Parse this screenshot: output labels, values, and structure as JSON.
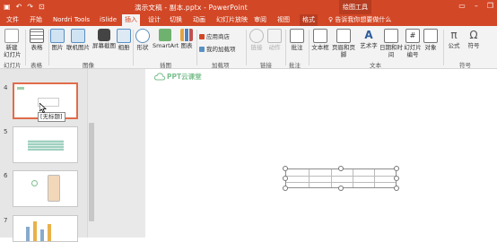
{
  "window": {
    "title": "演示文稿 - 副本.pptx - PowerPoint",
    "context_tool": "绘图工具",
    "qat_icons": [
      "save-icon",
      "undo-icon",
      "redo-icon",
      "start-from-beginning-icon"
    ],
    "win_icons": [
      "ribbon-options-icon",
      "minimize-icon",
      "restore-icon"
    ]
  },
  "tabs": [
    "文件",
    "开始",
    "Nordri Tools",
    "iSlide",
    "插入",
    "设计",
    "切换",
    "动画",
    "幻灯片放映",
    "审阅",
    "视图",
    "格式"
  ],
  "active_tab": "插入",
  "tell_me": "♀ 告诉我你想要做什么",
  "ribbon": {
    "new_slide": "新建\n幻灯片",
    "table": "表格",
    "picture": "图片",
    "online_picture": "联机图片",
    "screenshot": "屏幕截图",
    "album": "相册",
    "shapes": "形状",
    "smartart": "SmartArt",
    "chart": "图表",
    "store": "应用商店",
    "my_addins": "我的加载项",
    "link": "链接",
    "action": "动作",
    "comment": "批注",
    "textbox": "文本框",
    "header_footer": "页眉和页脚",
    "wordart": "艺术字",
    "datetime": "日期和时间",
    "slide_number": "幻灯片\n编号",
    "object": "对象",
    "equation": "公式",
    "symbol": "符号",
    "groups": {
      "slides": "幻灯片",
      "tables": "表格",
      "images": "图像",
      "illustrations": "插图",
      "addins": "加载项",
      "links": "链接",
      "comments": "批注",
      "text": "文本",
      "symbols": "符号"
    }
  },
  "thumbnails": [
    {
      "num": "4",
      "selected": true
    },
    {
      "num": "5",
      "selected": false
    },
    {
      "num": "6",
      "selected": false
    },
    {
      "num": "7",
      "selected": false
    }
  ],
  "tooltip": "[无标题]",
  "slide": {
    "logo_text": "PPT云课堂"
  },
  "colors": {
    "accent": "#d24726",
    "ribbon_bg": "#f3f3f3",
    "logo_green": "#7cc08f"
  }
}
